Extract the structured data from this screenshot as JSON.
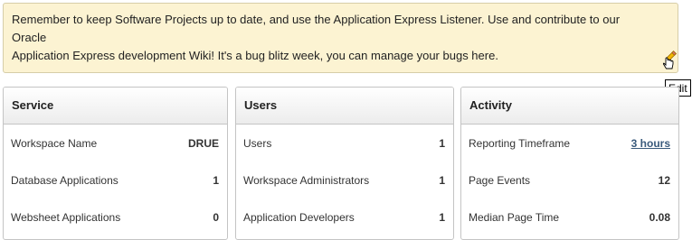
{
  "notice": {
    "text": "Remember to keep Software Projects up to date, and use the Application Express Listener. Use and contribute to our Oracle\nApplication Express development Wiki! It's a bug blitz week, you can manage your bugs here.",
    "edit_tooltip": "Edit"
  },
  "panels": {
    "service": {
      "title": "Service",
      "rows": [
        {
          "label": "Workspace Name",
          "value": "DRUE"
        },
        {
          "label": "Database Applications",
          "value": "1"
        },
        {
          "label": "Websheet Applications",
          "value": "0"
        }
      ]
    },
    "users": {
      "title": "Users",
      "rows": [
        {
          "label": "Users",
          "value": "1"
        },
        {
          "label": "Workspace Administrators",
          "value": "1"
        },
        {
          "label": "Application Developers",
          "value": "1"
        }
      ]
    },
    "activity": {
      "title": "Activity",
      "rows": [
        {
          "label": "Reporting Timeframe",
          "value": "3 hours"
        },
        {
          "label": "Page Events",
          "value": "12"
        },
        {
          "label": "Median Page Time",
          "value": "0.08"
        }
      ]
    }
  },
  "colors": {
    "notice_background": "#fcf3d2",
    "link": "#3a5a7c"
  },
  "icons": {
    "edit": "pencil-icon",
    "cursor": "hand-pointer-cursor"
  }
}
